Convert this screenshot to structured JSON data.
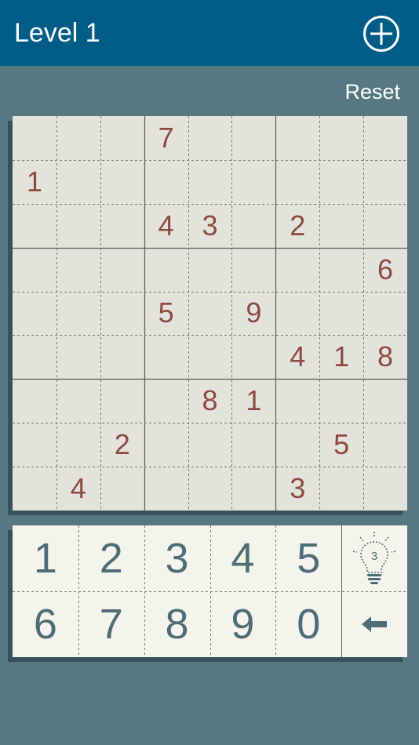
{
  "header": {
    "title": "Level 1",
    "add_icon": "plus-circle-icon"
  },
  "toolbar": {
    "reset_label": "Reset"
  },
  "board": {
    "cells": [
      [
        "",
        "",
        "",
        "7",
        "",
        "",
        "",
        "",
        ""
      ],
      [
        "1",
        "",
        "",
        "",
        "",
        "",
        "",
        "",
        ""
      ],
      [
        "",
        "",
        "",
        "4",
        "3",
        "",
        "2",
        "",
        ""
      ],
      [
        "",
        "",
        "",
        "",
        "",
        "",
        "",
        "",
        "6"
      ],
      [
        "",
        "",
        "",
        "5",
        "",
        "9",
        "",
        "",
        ""
      ],
      [
        "",
        "",
        "",
        "",
        "",
        "",
        "4",
        "1",
        "8"
      ],
      [
        "",
        "",
        "",
        "",
        "8",
        "1",
        "",
        "",
        ""
      ],
      [
        "",
        "",
        "2",
        "",
        "",
        "",
        "",
        "5",
        ""
      ],
      [
        "",
        "4",
        "",
        "",
        "",
        "",
        "3",
        "",
        ""
      ]
    ],
    "digit_color": "#8c4b3e"
  },
  "keypad": {
    "row1": [
      "1",
      "2",
      "3",
      "4",
      "5"
    ],
    "row2": [
      "6",
      "7",
      "8",
      "9",
      "0"
    ],
    "hint_count": "3",
    "hint_icon": "lightbulb-icon",
    "backspace_icon": "arrow-left-icon"
  },
  "colors": {
    "header_bg": "#015d88",
    "page_bg": "#557881",
    "board_bg": "#e3e3dc",
    "key_text": "#4f6d76"
  }
}
